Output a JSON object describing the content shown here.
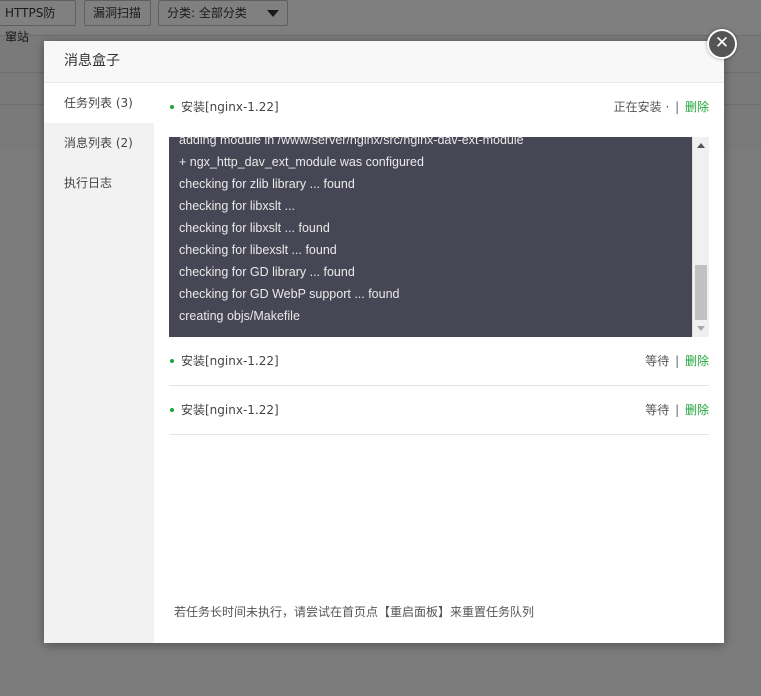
{
  "background": {
    "toolbar": {
      "https_label": "HTTPS防窜站",
      "scan_label": "漏洞扫描",
      "category_label": "分类: 全部分类"
    }
  },
  "modal": {
    "title": "消息盒子",
    "close_symbol": "✕",
    "sidebar": {
      "items": [
        {
          "label": "任务列表 (3)"
        },
        {
          "label": "消息列表 (2)"
        },
        {
          "label": "执行日志"
        }
      ]
    },
    "tasks": [
      {
        "name": "安装[nginx-1.22]",
        "status": "正在安装 ·",
        "separator": "|",
        "delete_label": "删除"
      },
      {
        "name": "安装[nginx-1.22]",
        "status": "等待",
        "separator": "|",
        "delete_label": "删除"
      },
      {
        "name": "安装[nginx-1.22]",
        "status": "等待",
        "separator": "|",
        "delete_label": "删除"
      }
    ],
    "log_lines": [
      "adding module in /www/server/nginx/src/nginx-dav-ext-module",
      "+ ngx_http_dav_ext_module was configured",
      "checking for zlib library ... found",
      "checking for libxslt ...",
      "checking for libxslt ... found",
      "checking for libexslt ... found",
      "checking for GD library ... found",
      "checking for GD WebP support ... found",
      "creating objs/Makefile"
    ],
    "tip": "若任务长时间未执行，请尝试在首页点【重启面板】来重置任务队列"
  },
  "colors": {
    "accent": "#20a53a",
    "log_bg": "#464655",
    "overlay": "#7a7a7a"
  }
}
